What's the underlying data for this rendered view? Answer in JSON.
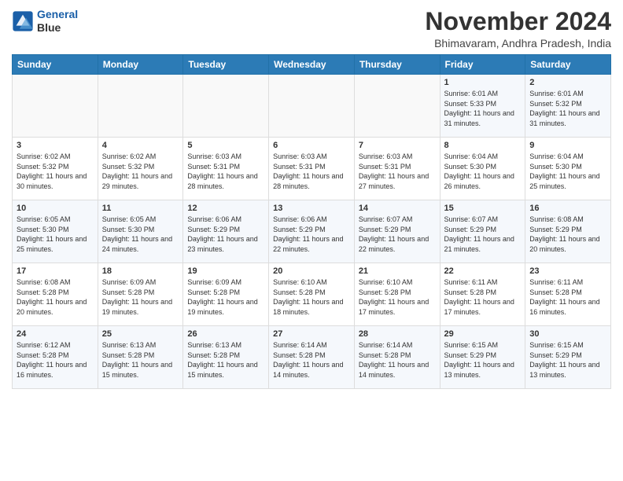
{
  "header": {
    "logo_line1": "General",
    "logo_line2": "Blue",
    "month": "November 2024",
    "location": "Bhimavaram, Andhra Pradesh, India"
  },
  "weekdays": [
    "Sunday",
    "Monday",
    "Tuesday",
    "Wednesday",
    "Thursday",
    "Friday",
    "Saturday"
  ],
  "weeks": [
    [
      {
        "day": "",
        "info": ""
      },
      {
        "day": "",
        "info": ""
      },
      {
        "day": "",
        "info": ""
      },
      {
        "day": "",
        "info": ""
      },
      {
        "day": "",
        "info": ""
      },
      {
        "day": "1",
        "info": "Sunrise: 6:01 AM\nSunset: 5:33 PM\nDaylight: 11 hours and 31 minutes."
      },
      {
        "day": "2",
        "info": "Sunrise: 6:01 AM\nSunset: 5:32 PM\nDaylight: 11 hours and 31 minutes."
      }
    ],
    [
      {
        "day": "3",
        "info": "Sunrise: 6:02 AM\nSunset: 5:32 PM\nDaylight: 11 hours and 30 minutes."
      },
      {
        "day": "4",
        "info": "Sunrise: 6:02 AM\nSunset: 5:32 PM\nDaylight: 11 hours and 29 minutes."
      },
      {
        "day": "5",
        "info": "Sunrise: 6:03 AM\nSunset: 5:31 PM\nDaylight: 11 hours and 28 minutes."
      },
      {
        "day": "6",
        "info": "Sunrise: 6:03 AM\nSunset: 5:31 PM\nDaylight: 11 hours and 28 minutes."
      },
      {
        "day": "7",
        "info": "Sunrise: 6:03 AM\nSunset: 5:31 PM\nDaylight: 11 hours and 27 minutes."
      },
      {
        "day": "8",
        "info": "Sunrise: 6:04 AM\nSunset: 5:30 PM\nDaylight: 11 hours and 26 minutes."
      },
      {
        "day": "9",
        "info": "Sunrise: 6:04 AM\nSunset: 5:30 PM\nDaylight: 11 hours and 25 minutes."
      }
    ],
    [
      {
        "day": "10",
        "info": "Sunrise: 6:05 AM\nSunset: 5:30 PM\nDaylight: 11 hours and 25 minutes."
      },
      {
        "day": "11",
        "info": "Sunrise: 6:05 AM\nSunset: 5:30 PM\nDaylight: 11 hours and 24 minutes."
      },
      {
        "day": "12",
        "info": "Sunrise: 6:06 AM\nSunset: 5:29 PM\nDaylight: 11 hours and 23 minutes."
      },
      {
        "day": "13",
        "info": "Sunrise: 6:06 AM\nSunset: 5:29 PM\nDaylight: 11 hours and 22 minutes."
      },
      {
        "day": "14",
        "info": "Sunrise: 6:07 AM\nSunset: 5:29 PM\nDaylight: 11 hours and 22 minutes."
      },
      {
        "day": "15",
        "info": "Sunrise: 6:07 AM\nSunset: 5:29 PM\nDaylight: 11 hours and 21 minutes."
      },
      {
        "day": "16",
        "info": "Sunrise: 6:08 AM\nSunset: 5:29 PM\nDaylight: 11 hours and 20 minutes."
      }
    ],
    [
      {
        "day": "17",
        "info": "Sunrise: 6:08 AM\nSunset: 5:28 PM\nDaylight: 11 hours and 20 minutes."
      },
      {
        "day": "18",
        "info": "Sunrise: 6:09 AM\nSunset: 5:28 PM\nDaylight: 11 hours and 19 minutes."
      },
      {
        "day": "19",
        "info": "Sunrise: 6:09 AM\nSunset: 5:28 PM\nDaylight: 11 hours and 19 minutes."
      },
      {
        "day": "20",
        "info": "Sunrise: 6:10 AM\nSunset: 5:28 PM\nDaylight: 11 hours and 18 minutes."
      },
      {
        "day": "21",
        "info": "Sunrise: 6:10 AM\nSunset: 5:28 PM\nDaylight: 11 hours and 17 minutes."
      },
      {
        "day": "22",
        "info": "Sunrise: 6:11 AM\nSunset: 5:28 PM\nDaylight: 11 hours and 17 minutes."
      },
      {
        "day": "23",
        "info": "Sunrise: 6:11 AM\nSunset: 5:28 PM\nDaylight: 11 hours and 16 minutes."
      }
    ],
    [
      {
        "day": "24",
        "info": "Sunrise: 6:12 AM\nSunset: 5:28 PM\nDaylight: 11 hours and 16 minutes."
      },
      {
        "day": "25",
        "info": "Sunrise: 6:13 AM\nSunset: 5:28 PM\nDaylight: 11 hours and 15 minutes."
      },
      {
        "day": "26",
        "info": "Sunrise: 6:13 AM\nSunset: 5:28 PM\nDaylight: 11 hours and 15 minutes."
      },
      {
        "day": "27",
        "info": "Sunrise: 6:14 AM\nSunset: 5:28 PM\nDaylight: 11 hours and 14 minutes."
      },
      {
        "day": "28",
        "info": "Sunrise: 6:14 AM\nSunset: 5:28 PM\nDaylight: 11 hours and 14 minutes."
      },
      {
        "day": "29",
        "info": "Sunrise: 6:15 AM\nSunset: 5:29 PM\nDaylight: 11 hours and 13 minutes."
      },
      {
        "day": "30",
        "info": "Sunrise: 6:15 AM\nSunset: 5:29 PM\nDaylight: 11 hours and 13 minutes."
      }
    ]
  ]
}
